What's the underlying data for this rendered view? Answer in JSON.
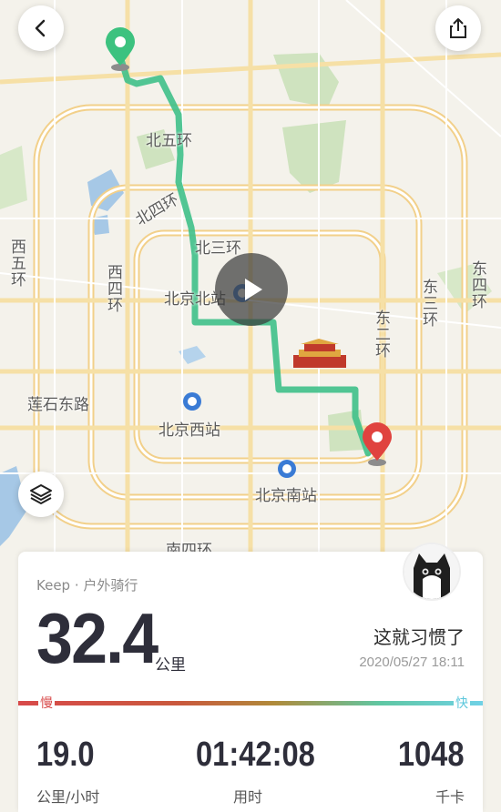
{
  "map": {
    "labels": {
      "north5": "北五环",
      "north4": "北四环",
      "north3": "北三环",
      "west5": "西五环",
      "west4": "西四环",
      "east2": "东二环",
      "east3": "东三环",
      "east4": "东四环",
      "lianshi": "莲石东路",
      "beijing_north": "北京北站",
      "beijing_west": "北京西站",
      "beijing_south": "北京南站",
      "south4": "南四环"
    }
  },
  "buttons": {
    "back_icon": "chevron-left-icon",
    "share_icon": "share-icon",
    "layers_icon": "layers-icon",
    "play_icon": "play-icon"
  },
  "card": {
    "source": "Keep · 户外骑行",
    "distance": "32.4",
    "distance_unit": "公里",
    "caption": "这就习惯了",
    "datetime": "2020/05/27 18:11",
    "speed_slow": "慢",
    "speed_fast": "快",
    "stats": [
      {
        "value": "19.0",
        "label": "公里/小时"
      },
      {
        "value": "01:42:08",
        "label": "用时"
      },
      {
        "value": "1048",
        "label": "千卡"
      }
    ]
  },
  "colors": {
    "route": "#3fc08a",
    "start_pin": "#3cc27f",
    "end_pin": "#e0433f"
  }
}
